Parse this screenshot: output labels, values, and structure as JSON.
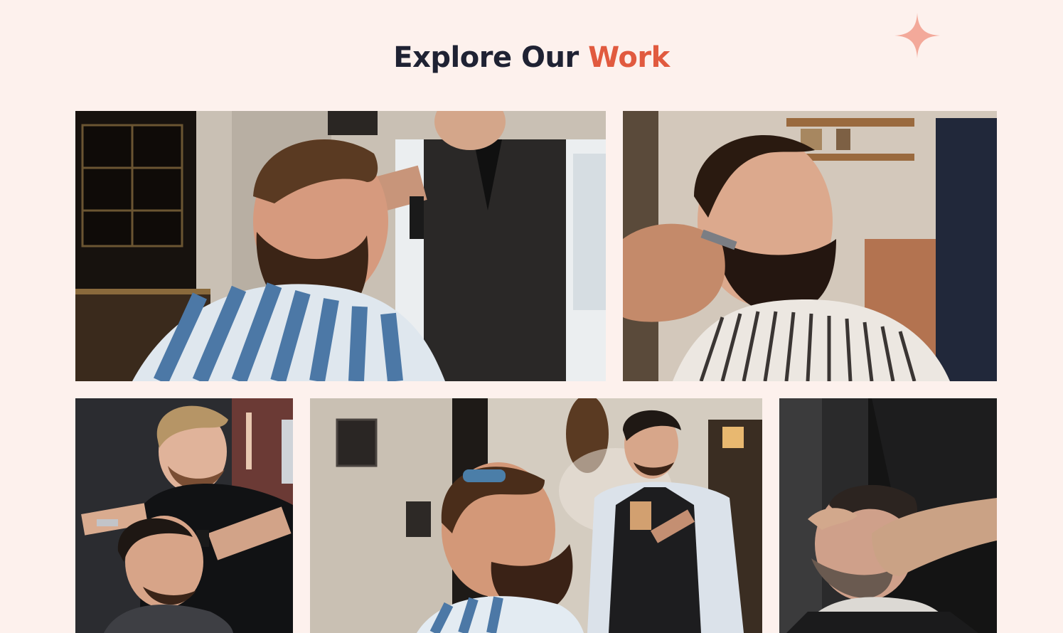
{
  "section": {
    "title_part1": "Explore Our",
    "title_part2": "Work",
    "title_color": "#1f2233",
    "accent_color": "#e15a3f",
    "background_color": "#fdf1ed",
    "decoration_icon": "sparkle-icon"
  },
  "gallery": {
    "images": [
      "barber trimming the hair of a bearded man wearing a blue striped cape",
      "barber trimming the beard of a man wearing a black and white striped cape",
      "barber in a black t-shirt cutting a young man's hair with scissors and comb",
      "barber spraying water onto a bearded client's hair in a barbershop",
      "barber massaging the face of a man with closed eyes"
    ]
  }
}
